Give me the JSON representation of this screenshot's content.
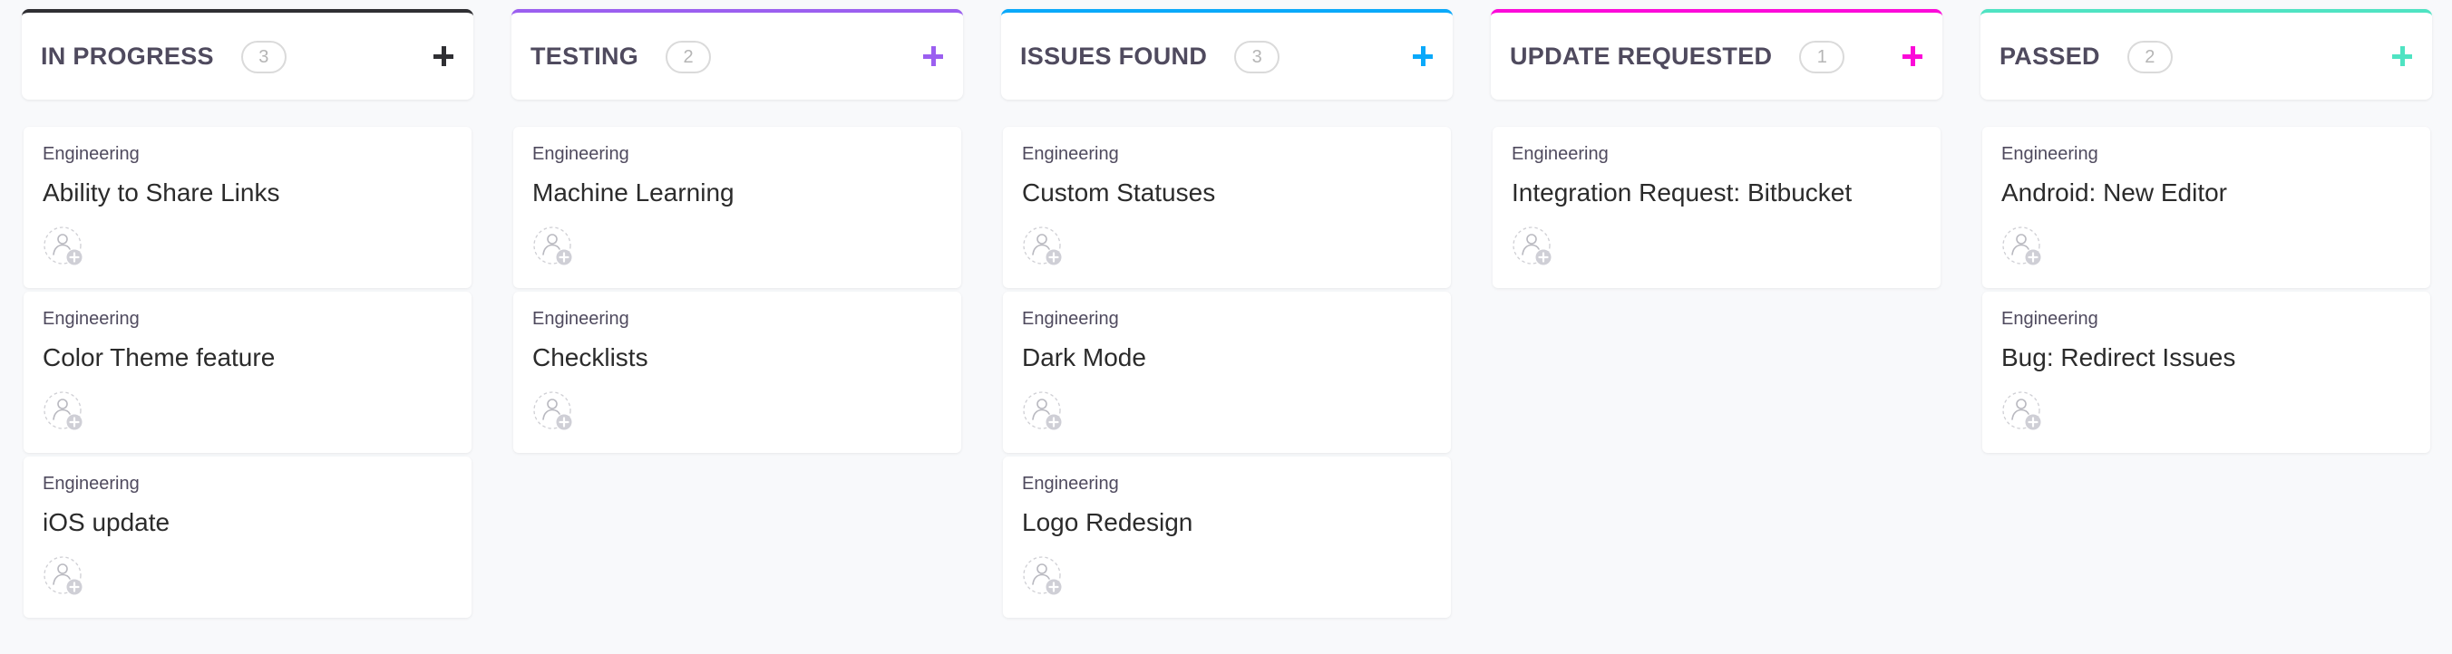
{
  "board": {
    "columns": [
      {
        "title": "IN PROGRESS",
        "count": "3",
        "accent": "#2f2f33",
        "add_icon": "plus-icon",
        "cards": [
          {
            "category": "Engineering",
            "title": "Ability to Share Links",
            "assignee_icon": "add-assignee-icon"
          },
          {
            "category": "Engineering",
            "title": "Color Theme feature",
            "assignee_icon": "add-assignee-icon"
          },
          {
            "category": "Engineering",
            "title": "iOS update",
            "assignee_icon": "add-assignee-icon"
          }
        ]
      },
      {
        "title": "TESTING",
        "count": "2",
        "accent": "#9b5ff0",
        "add_icon": "plus-icon",
        "cards": [
          {
            "category": "Engineering",
            "title": "Machine Learning",
            "assignee_icon": "add-assignee-icon"
          },
          {
            "category": "Engineering",
            "title": "Checklists",
            "assignee_icon": "add-assignee-icon"
          }
        ]
      },
      {
        "title": "ISSUES FOUND",
        "count": "3",
        "accent": "#0aa9fa",
        "add_icon": "plus-icon",
        "cards": [
          {
            "category": "Engineering",
            "title": "Custom Statuses",
            "assignee_icon": "add-assignee-icon"
          },
          {
            "category": "Engineering",
            "title": "Dark Mode",
            "assignee_icon": "add-assignee-icon"
          },
          {
            "category": "Engineering",
            "title": "Logo Redesign",
            "assignee_icon": "add-assignee-icon"
          }
        ]
      },
      {
        "title": "UPDATE REQUESTED",
        "count": "1",
        "accent": "#fc0ad9",
        "add_icon": "plus-icon",
        "cards": [
          {
            "category": "Engineering",
            "title": "Integration Request: Bitbucket",
            "assignee_icon": "add-assignee-icon"
          }
        ]
      },
      {
        "title": "PASSED",
        "count": "2",
        "accent": "#4fe3c2",
        "add_icon": "plus-icon",
        "cards": [
          {
            "category": "Engineering",
            "title": "Android: New Editor",
            "assignee_icon": "add-assignee-icon"
          },
          {
            "category": "Engineering",
            "title": "Bug: Redirect Issues",
            "assignee_icon": "add-assignee-icon"
          }
        ]
      }
    ]
  }
}
